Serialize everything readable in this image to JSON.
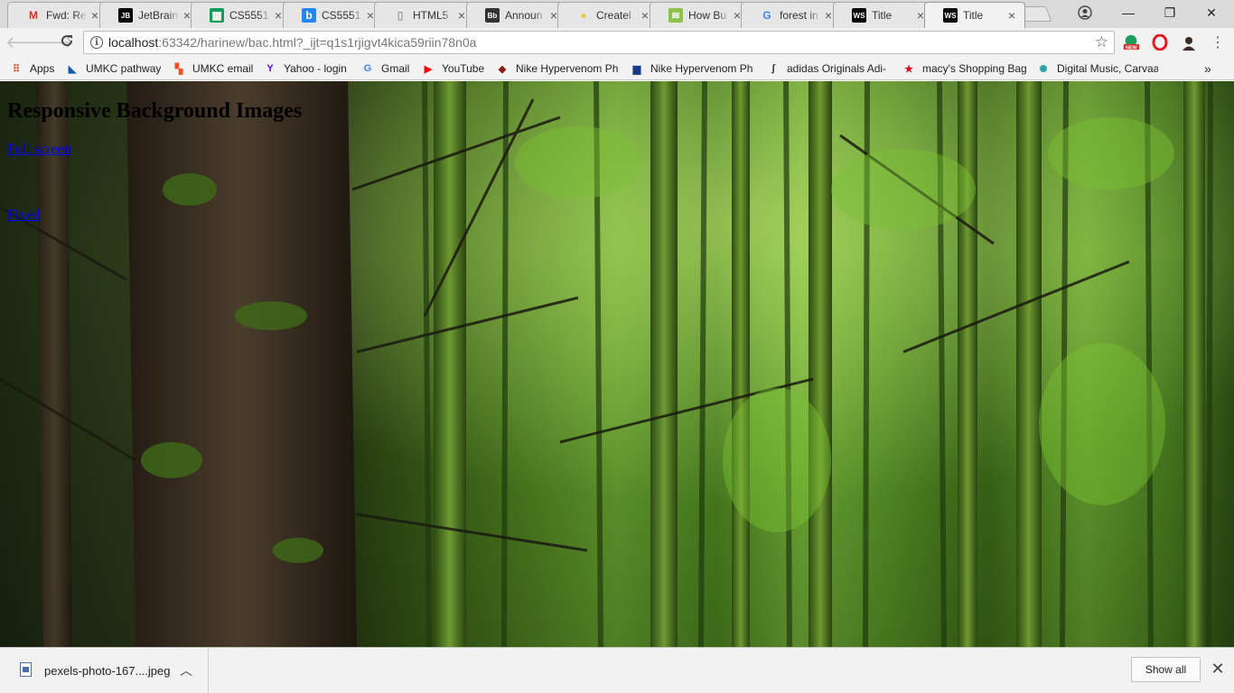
{
  "browser": {
    "tabs": [
      {
        "label": "Fwd: Re",
        "favicon": "gmail-icon",
        "favicon_color": "#d93025",
        "active": false
      },
      {
        "label": "JetBrain",
        "favicon": "jetbrains-icon",
        "favicon_color": "#000000",
        "active": false
      },
      {
        "label": "CS5551",
        "favicon": "sheets-icon",
        "favicon_color": "#0f9d58",
        "active": false
      },
      {
        "label": "CS5551",
        "favicon": "box-icon",
        "favicon_color": "#2486fc",
        "active": false
      },
      {
        "label": "HTML5",
        "favicon": "page-icon",
        "favicon_color": "#9e9e9e",
        "active": false
      },
      {
        "label": "Announ",
        "favicon": "blackboard-icon",
        "favicon_color": "#333333",
        "active": false
      },
      {
        "label": "Createl",
        "favicon": "bulb-icon",
        "favicon_color": "#f4c542",
        "active": false
      },
      {
        "label": "How Bu",
        "favicon": "stack-icon",
        "favicon_color": "#8bc34a",
        "active": false
      },
      {
        "label": "forest in",
        "favicon": "google-icon",
        "favicon_color": "#4285f4",
        "active": false
      },
      {
        "label": "Title",
        "favicon": "webstorm-icon",
        "favicon_color": "#000000",
        "active": false
      },
      {
        "label": "Title",
        "favicon": "webstorm-icon",
        "favicon_color": "#000000",
        "active": true
      }
    ],
    "tab_close_glyph": "×",
    "window_buttons": {
      "minimize": "—",
      "maximize": "❐",
      "close": "✕"
    },
    "address": {
      "host": "localhost",
      "rest": ":63342/harinew/bac.html?_ijt=q1s1rjigvt4kica59riin78n0a"
    },
    "bookmarks": [
      {
        "label": "Apps",
        "icon": "apps-grid-icon"
      },
      {
        "label": "UMKC pathway",
        "icon": "umkc-icon"
      },
      {
        "label": "UMKC email",
        "icon": "windows-icon"
      },
      {
        "label": "Yahoo - login",
        "icon": "yahoo-icon"
      },
      {
        "label": "Gmail",
        "icon": "google-icon"
      },
      {
        "label": "YouTube",
        "icon": "youtube-icon"
      },
      {
        "label": "Nike Hypervenom Ph",
        "icon": "shield-icon"
      },
      {
        "label": "Nike Hypervenom Ph",
        "icon": "store-icon"
      },
      {
        "label": "adidas Originals Adi-",
        "icon": "feather-icon"
      },
      {
        "label": "macy's Shopping Bag",
        "icon": "star-icon"
      },
      {
        "label": "Digital Music, Carvaa",
        "icon": "music-icon"
      }
    ],
    "overflow_glyph": "»"
  },
  "page": {
    "heading": "Responsive Background Images",
    "links": [
      "Full screen",
      "Fixed"
    ]
  },
  "downloads": {
    "file_name": "pexels-photo-167....jpeg",
    "show_all": "Show all"
  }
}
